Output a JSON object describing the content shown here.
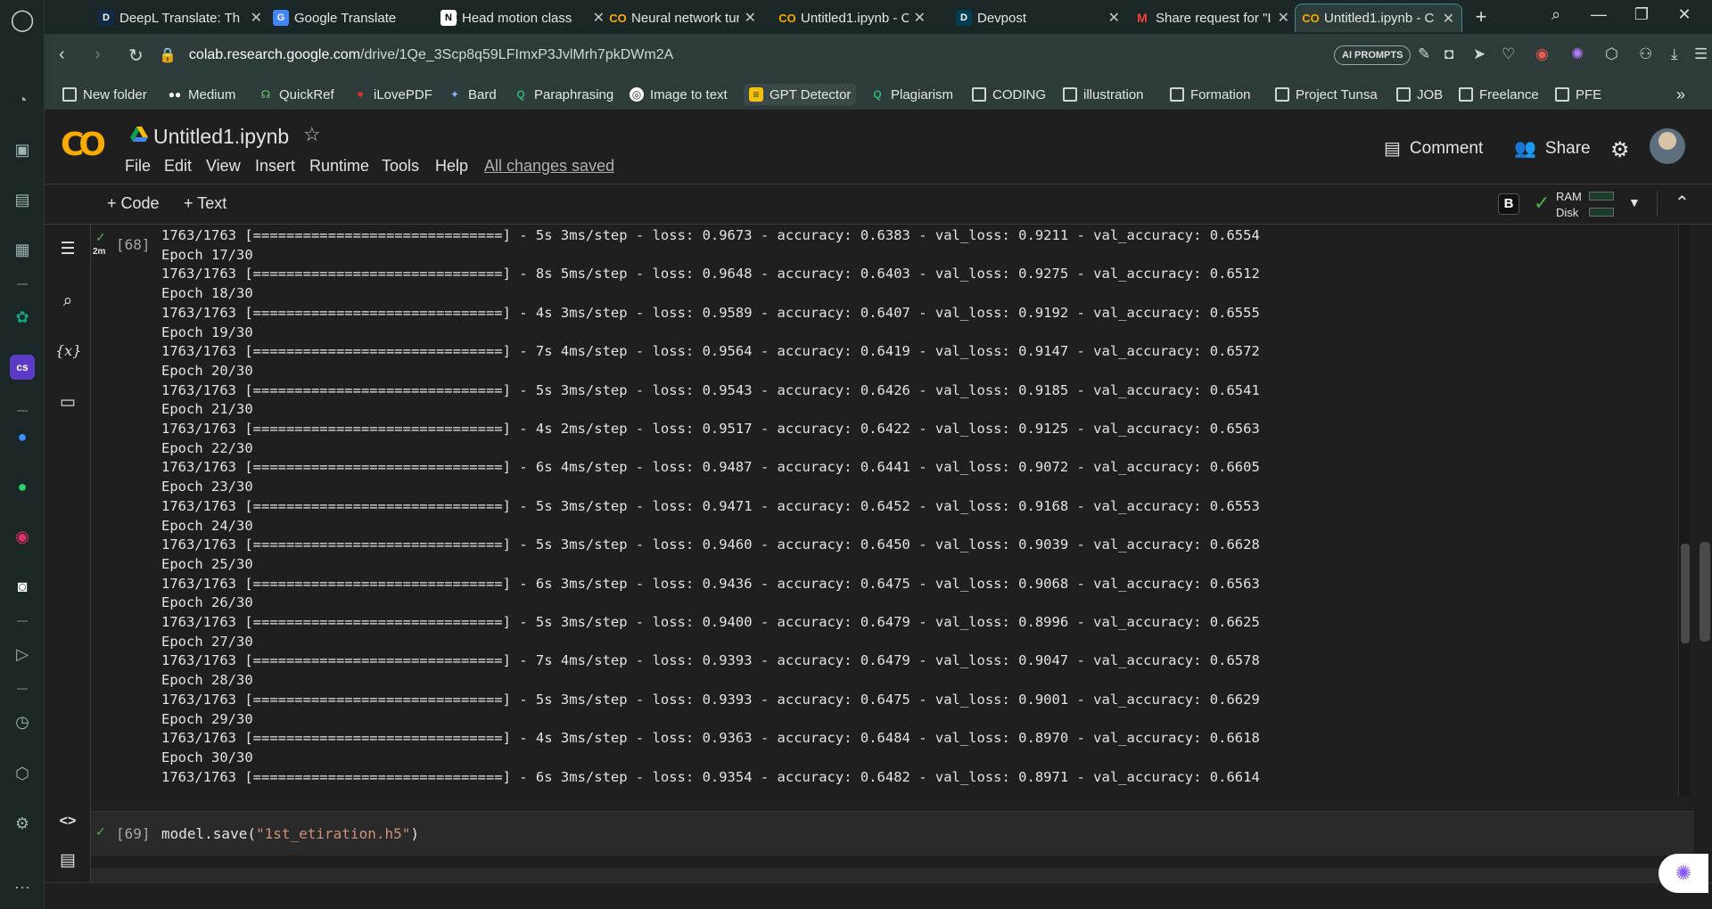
{
  "browser": {
    "tabs": [
      {
        "title": "DeepL Translate: Th",
        "favicon": "deepl-icon"
      },
      {
        "title": "Google Translate",
        "favicon": "google-translate-icon"
      },
      {
        "title": "Head motion class",
        "favicon": "notion-icon"
      },
      {
        "title": "Neural network tur",
        "favicon": "colab-icon"
      },
      {
        "title": "Untitled1.ipynb - C",
        "favicon": "colab-icon"
      },
      {
        "title": "Devpost",
        "favicon": "devpost-icon"
      },
      {
        "title": "Share request for \"I",
        "favicon": "gmail-icon"
      },
      {
        "title": "Untitled1.ipynb - C",
        "favicon": "colab-icon",
        "active": true
      }
    ],
    "url_host": "colab.research.google.com",
    "url_path": "/drive/1Qe_3Scp8q59LFImxP3JvlMrh7pkDWm2A",
    "ai_prompts_label": "AI PROMPTS",
    "bookmarks": [
      "New folder",
      "Medium",
      "QuickRef",
      "iLovePDF",
      "Bard",
      "Paraphrasing",
      "Image to text",
      "GPT Detector",
      "Plagiarism",
      "CODING",
      "illustration",
      "Formation",
      "Project Tunsa",
      "JOB",
      "Freelance",
      "PFE"
    ]
  },
  "colab": {
    "notebook_title": "Untitled1.ipynb",
    "menu": [
      "File",
      "Edit",
      "View",
      "Insert",
      "Runtime",
      "Tools",
      "Help"
    ],
    "save_status": "All changes saved",
    "comment_label": "Comment",
    "share_label": "Share",
    "toolbar": {
      "add_code": "+ Code",
      "add_text": "+ Text",
      "badge": "B",
      "ram_label": "RAM",
      "disk_label": "Disk"
    },
    "output_cell": {
      "exec_count": "[68]",
      "run_time": "2m",
      "lines": [
        "1763/1763 [==============================] - 5s 3ms/step - loss: 0.9673 - accuracy: 0.6383 - val_loss: 0.9211 - val_accuracy: 0.6554",
        "Epoch 17/30",
        "1763/1763 [==============================] - 8s 5ms/step - loss: 0.9648 - accuracy: 0.6403 - val_loss: 0.9275 - val_accuracy: 0.6512",
        "Epoch 18/30",
        "1763/1763 [==============================] - 4s 3ms/step - loss: 0.9589 - accuracy: 0.6407 - val_loss: 0.9192 - val_accuracy: 0.6555",
        "Epoch 19/30",
        "1763/1763 [==============================] - 7s 4ms/step - loss: 0.9564 - accuracy: 0.6419 - val_loss: 0.9147 - val_accuracy: 0.6572",
        "Epoch 20/30",
        "1763/1763 [==============================] - 5s 3ms/step - loss: 0.9543 - accuracy: 0.6426 - val_loss: 0.9185 - val_accuracy: 0.6541",
        "Epoch 21/30",
        "1763/1763 [==============================] - 4s 2ms/step - loss: 0.9517 - accuracy: 0.6422 - val_loss: 0.9125 - val_accuracy: 0.6563",
        "Epoch 22/30",
        "1763/1763 [==============================] - 6s 4ms/step - loss: 0.9487 - accuracy: 0.6441 - val_loss: 0.9072 - val_accuracy: 0.6605",
        "Epoch 23/30",
        "1763/1763 [==============================] - 5s 3ms/step - loss: 0.9471 - accuracy: 0.6452 - val_loss: 0.9168 - val_accuracy: 0.6553",
        "Epoch 24/30",
        "1763/1763 [==============================] - 5s 3ms/step - loss: 0.9460 - accuracy: 0.6450 - val_loss: 0.9039 - val_accuracy: 0.6628",
        "Epoch 25/30",
        "1763/1763 [==============================] - 6s 3ms/step - loss: 0.9436 - accuracy: 0.6475 - val_loss: 0.9068 - val_accuracy: 0.6563",
        "Epoch 26/30",
        "1763/1763 [==============================] - 5s 3ms/step - loss: 0.9400 - accuracy: 0.6479 - val_loss: 0.8996 - val_accuracy: 0.6625",
        "Epoch 27/30",
        "1763/1763 [==============================] - 7s 4ms/step - loss: 0.9393 - accuracy: 0.6479 - val_loss: 0.9047 - val_accuracy: 0.6578",
        "Epoch 28/30",
        "1763/1763 [==============================] - 5s 3ms/step - loss: 0.9393 - accuracy: 0.6475 - val_loss: 0.9001 - val_accuracy: 0.6629",
        "Epoch 29/30",
        "1763/1763 [==============================] - 4s 3ms/step - loss: 0.9363 - accuracy: 0.6484 - val_loss: 0.8970 - val_accuracy: 0.6618",
        "Epoch 30/30",
        "1763/1763 [==============================] - 6s 3ms/step - loss: 0.9354 - accuracy: 0.6482 - val_loss: 0.8971 - val_accuracy: 0.6614"
      ]
    },
    "code_cell": {
      "exec_count": "[69]",
      "code_prefix": "model.save(",
      "code_string": "\"1st_etiration.h5\"",
      "code_suffix": ")"
    }
  },
  "colors": {
    "accent_green": "#4caf50",
    "colab_orange": "#f9ab00",
    "active_tab_border": "#3e8b8b"
  }
}
